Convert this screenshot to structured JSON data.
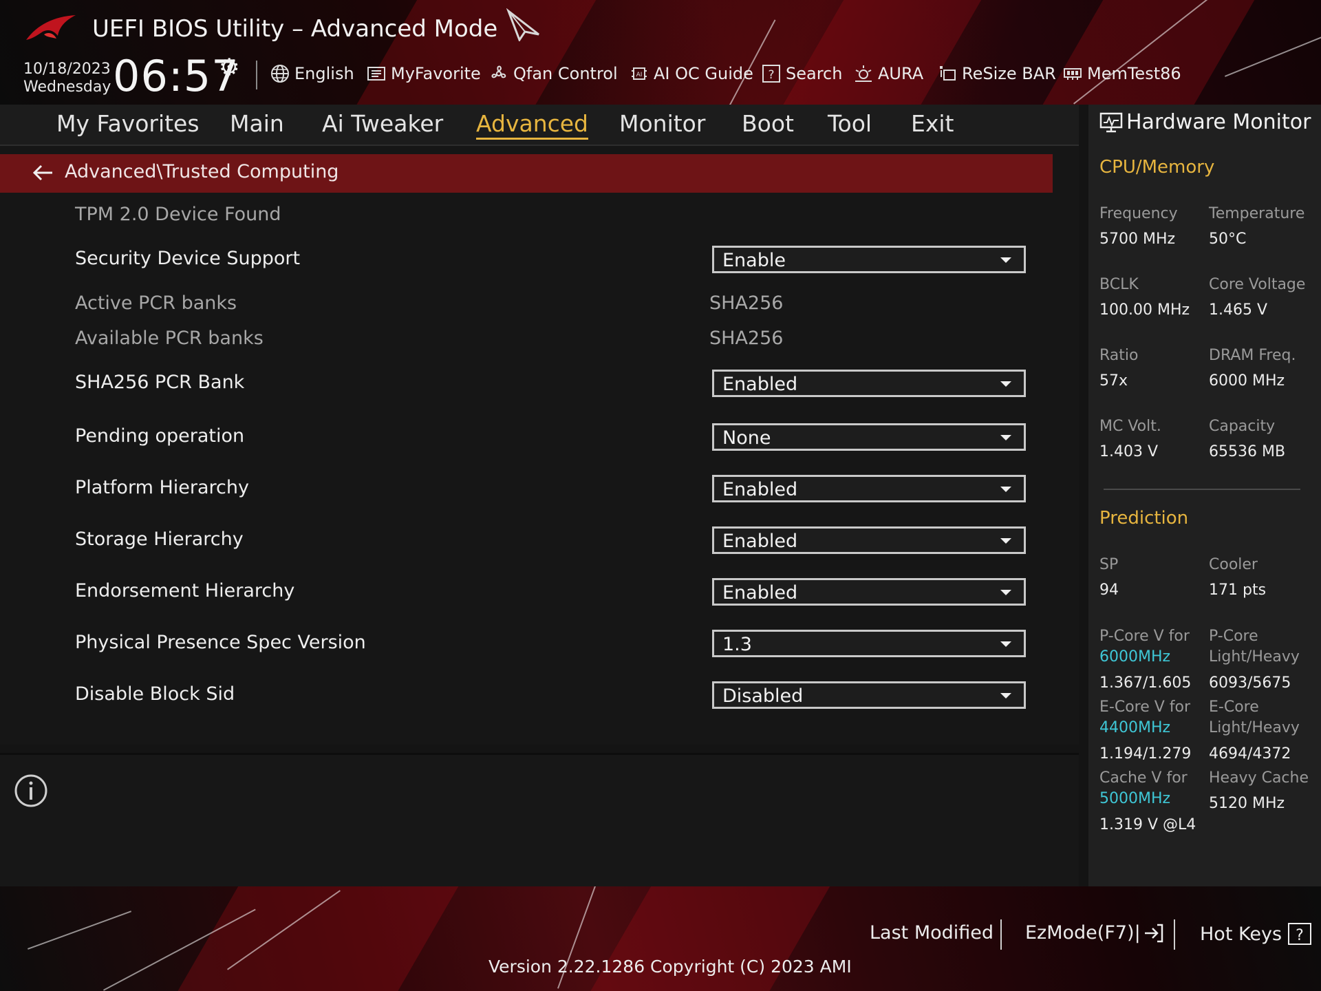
{
  "header": {
    "title": "UEFI BIOS Utility – Advanced Mode",
    "date": "10/18/2023",
    "day": "Wednesday",
    "time": "06:57",
    "tools": [
      {
        "label": "English",
        "icon": "globe-icon"
      },
      {
        "label": "MyFavorite",
        "icon": "favorite-list-icon"
      },
      {
        "label": "Qfan Control",
        "icon": "fan-icon"
      },
      {
        "label": "AI OC Guide",
        "icon": "ai-chip-icon"
      },
      {
        "label": "Search",
        "icon": "help-search-icon"
      },
      {
        "label": "AURA",
        "icon": "aura-light-icon"
      },
      {
        "label": "ReSize BAR",
        "icon": "resize-bar-icon"
      },
      {
        "label": "MemTest86",
        "icon": "memory-icon"
      }
    ]
  },
  "menu": {
    "tabs": [
      "My Favorites",
      "Main",
      "Ai Tweaker",
      "Advanced",
      "Monitor",
      "Boot",
      "Tool",
      "Exit"
    ],
    "active": "Advanced"
  },
  "page": {
    "breadcrumb": "Advanced\\Trusted Computing",
    "tpm_found": "TPM 2.0 Device Found",
    "active_pcr_label": "Active PCR banks",
    "active_pcr_value": "SHA256",
    "available_pcr_label": "Available PCR banks",
    "available_pcr_value": "SHA256",
    "settings": [
      {
        "label": "Security Device Support",
        "value": "Enable"
      },
      {
        "label": "SHA256 PCR Bank",
        "value": "Enabled"
      },
      {
        "label": "Pending operation",
        "value": "None"
      },
      {
        "label": "Platform Hierarchy",
        "value": "Enabled"
      },
      {
        "label": "Storage Hierarchy",
        "value": "Enabled"
      },
      {
        "label": "Endorsement Hierarchy",
        "value": "Enabled"
      },
      {
        "label": "Physical Presence Spec Version",
        "value": "1.3"
      },
      {
        "label": "Disable Block Sid",
        "value": "Disabled"
      }
    ]
  },
  "hw": {
    "title": "Hardware Monitor",
    "cpu_section": "CPU/Memory",
    "frequency_label": "Frequency",
    "frequency": "5700 MHz",
    "temperature_label": "Temperature",
    "temperature": "50°C",
    "bclk_label": "BCLK",
    "bclk": "100.00 MHz",
    "core_voltage_label": "Core Voltage",
    "core_voltage": "1.465 V",
    "ratio_label": "Ratio",
    "ratio": "57x",
    "dram_label": "DRAM Freq.",
    "dram": "6000 MHz",
    "mc_label": "MC Volt.",
    "mc": "1.403 V",
    "capacity_label": "Capacity",
    "capacity": "65536 MB",
    "prediction_section": "Prediction",
    "sp_label": "SP",
    "sp": "94",
    "cooler_label": "Cooler",
    "cooler": "171 pts",
    "pcore_v_label": "P-Core V for",
    "pcore_v_freq": "6000MHz",
    "pcore_v": "1.367/1.605",
    "pcore_lh_label1": "P-Core",
    "pcore_lh_label2": "Light/Heavy",
    "pcore_lh": "6093/5675",
    "ecore_v_label": "E-Core V for",
    "ecore_v_freq": "4400MHz",
    "ecore_v": "1.194/1.279",
    "ecore_lh_label1": "E-Core",
    "ecore_lh_label2": "Light/Heavy",
    "ecore_lh": "4694/4372",
    "cache_v_label": "Cache V for",
    "cache_v_freq": "5000MHz",
    "cache_v": "1.319 V @L4",
    "heavy_cache_label": "Heavy Cache",
    "heavy_cache": "5120 MHz"
  },
  "footer": {
    "last_modified": "Last Modified",
    "ezmode": "EzMode(F7)|",
    "hotkeys": "Hot Keys",
    "version": "Version 2.22.1286 Copyright (C) 2023 AMI"
  },
  "colors": {
    "accent": "#e7b53f",
    "breadcrumb_bg": "#6e1416",
    "cyan": "#3fc7d6"
  }
}
